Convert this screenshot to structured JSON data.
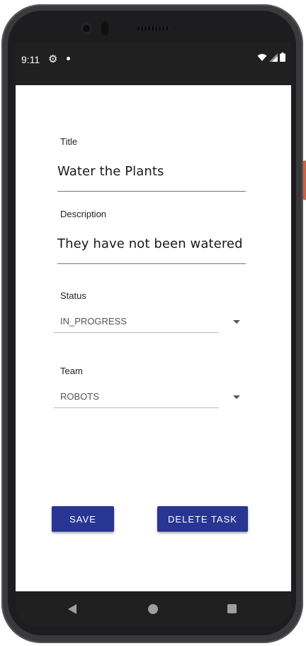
{
  "status_bar": {
    "time": "9:11",
    "icons": [
      "settings-icon",
      "notification-dot-icon",
      "wifi-icon",
      "signal-icon",
      "battery-icon"
    ]
  },
  "form": {
    "title_label": "Title",
    "title_value": "Water the Plants",
    "description_label": "Description",
    "description_value": "They have not been watered for d",
    "status_label": "Status",
    "status_value": "IN_PROGRESS",
    "team_label": "Team",
    "team_value": "ROBOTS"
  },
  "actions": {
    "save_label": "SAVE",
    "delete_label": "DELETE TASK"
  },
  "navigation": {
    "icons": [
      "back-icon",
      "home-icon",
      "recent-apps-icon"
    ]
  },
  "colors": {
    "button": "#283593",
    "system_bars": "#202020",
    "screen_background": "#ffffff"
  }
}
